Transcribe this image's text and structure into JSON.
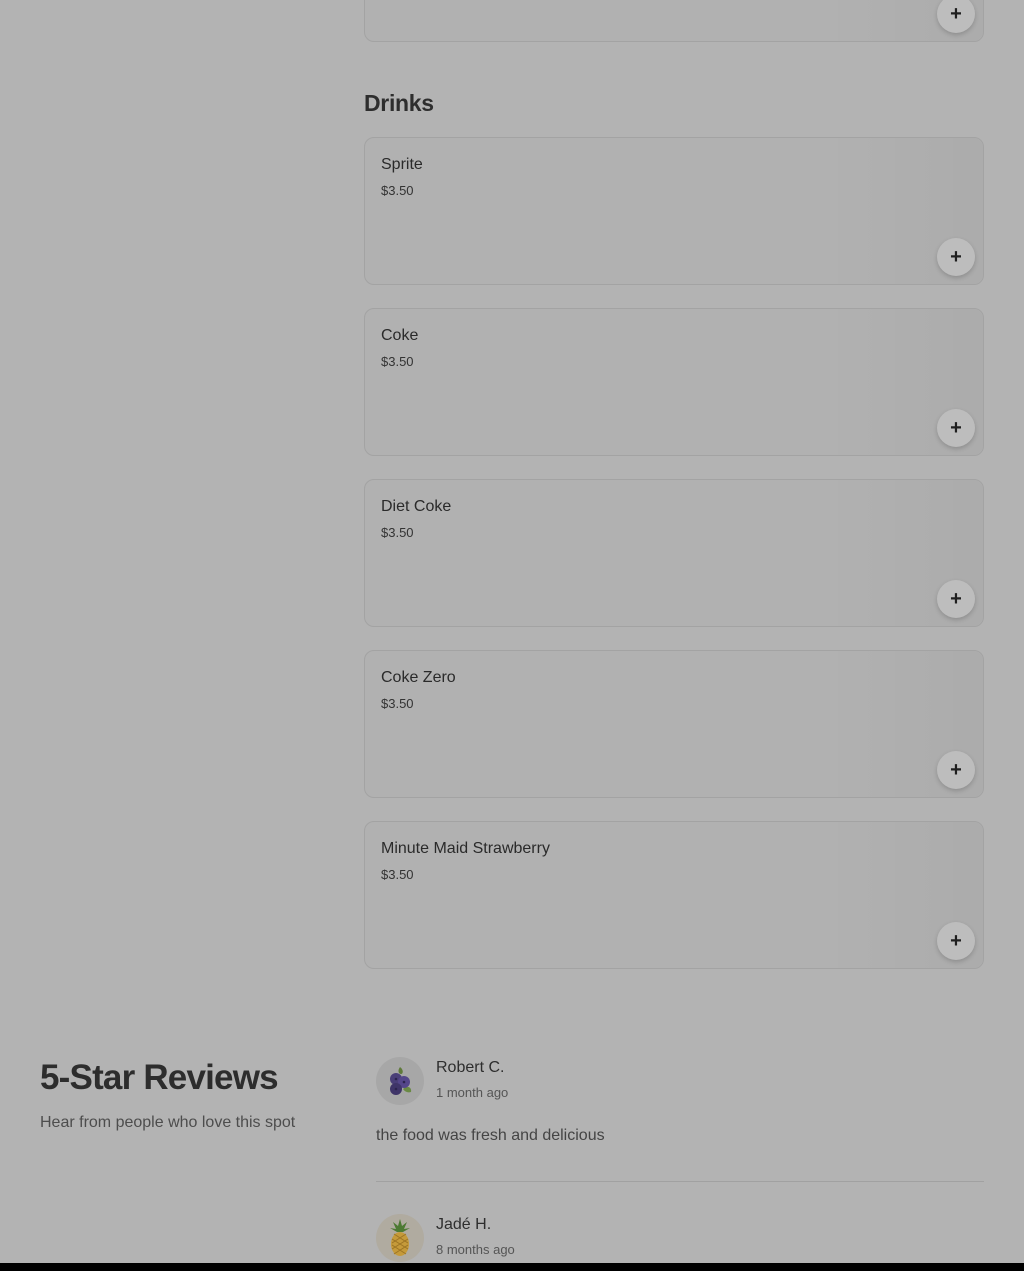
{
  "top_card": {
    "add_label": "+"
  },
  "drinks": {
    "title": "Drinks",
    "items": [
      {
        "name": "Sprite",
        "price": "$3.50",
        "add_label": "+"
      },
      {
        "name": "Coke",
        "price": "$3.50",
        "add_label": "+"
      },
      {
        "name": "Diet Coke",
        "price": "$3.50",
        "add_label": "+"
      },
      {
        "name": "Coke Zero",
        "price": "$3.50",
        "add_label": "+"
      },
      {
        "name": "Minute Maid Strawberry",
        "price": "$3.50",
        "add_label": "+"
      }
    ]
  },
  "reviews": {
    "title": "5-Star Reviews",
    "subtitle": "Hear from people who love this spot",
    "items": [
      {
        "name": "Robert C.",
        "time": "1 month ago",
        "text": "the food was fresh and delicious",
        "avatar_icon": "blueberry-icon"
      },
      {
        "name": "Jadé H.",
        "time": "8 months ago",
        "text": "",
        "avatar_icon": "pineapple-icon"
      }
    ]
  }
}
